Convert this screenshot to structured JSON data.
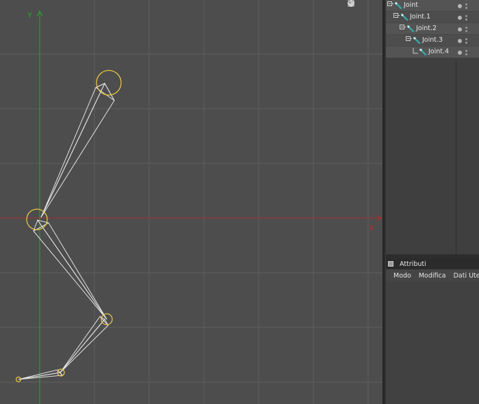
{
  "viewport": {
    "axis_y_label": "Y",
    "axis_x_label": "X",
    "colors": {
      "grid": "#5e5e5e",
      "x_axis": "#b32c2c",
      "y_axis": "#2fa32f",
      "bone": "#e6e6e6",
      "joint": "#e8c547"
    },
    "toolbar_icons": [
      "move-view-icon",
      "zoom-view-icon",
      "rotate-view-icon",
      "maximize-view-icon"
    ]
  },
  "object_manager": {
    "items": [
      {
        "label": "Joint",
        "depth": 0
      },
      {
        "label": "Joint.1",
        "depth": 1
      },
      {
        "label": "Joint.2",
        "depth": 2
      },
      {
        "label": "Joint.3",
        "depth": 3
      },
      {
        "label": "Joint.4",
        "depth": 4
      }
    ]
  },
  "attributes": {
    "title": "Attributi",
    "menu": [
      "Modo",
      "Modifica",
      "Dati Ute"
    ]
  }
}
